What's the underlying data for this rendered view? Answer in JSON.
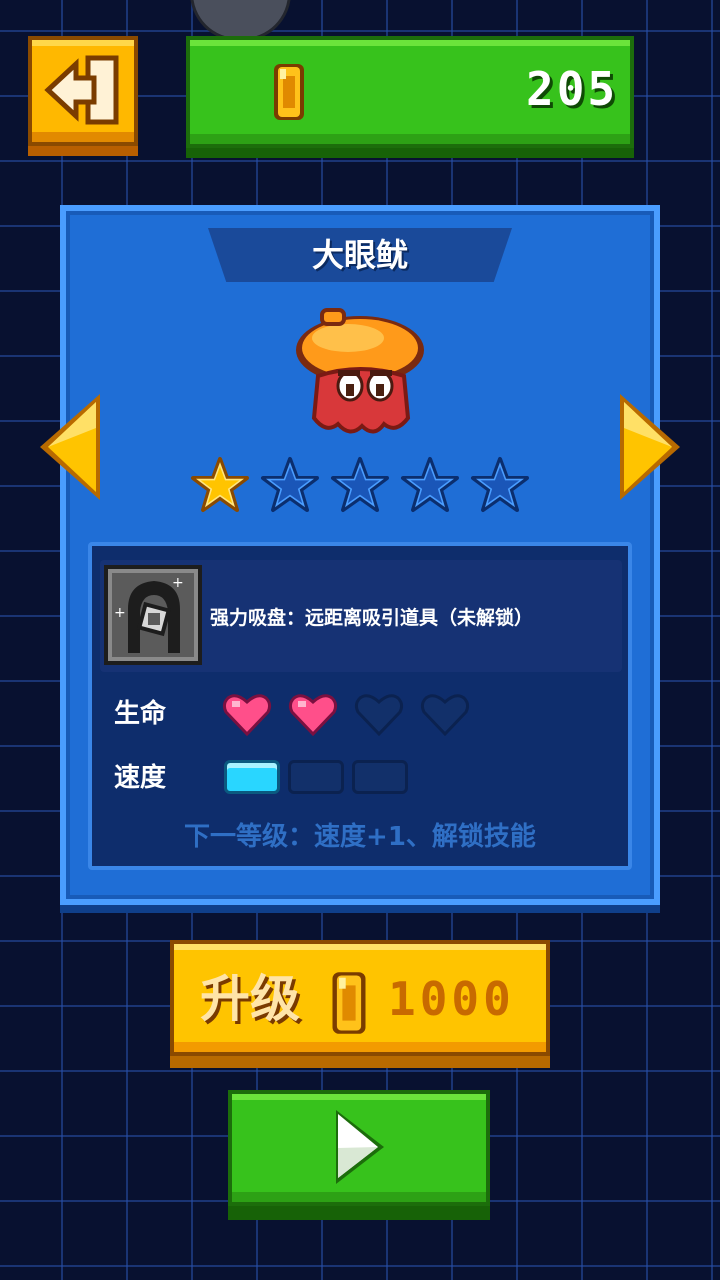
{
  "header": {
    "coins": "205"
  },
  "character": {
    "name": "大眼鱿",
    "stars_filled": 1,
    "stars_total": 5
  },
  "skill": {
    "description": "强力吸盘：远距离吸引道具（未解锁）"
  },
  "stats": {
    "life_label": "生命",
    "life_filled": 2,
    "life_total": 4,
    "speed_label": "速度",
    "speed_filled": 1,
    "speed_total": 3
  },
  "next_level_text": "下一等级：速度+1、解锁技能",
  "upgrade": {
    "label": "升级",
    "cost": "1000"
  },
  "icons": {
    "back": "exit-door-icon",
    "coin": "coin-icon",
    "play": "play-icon",
    "prev": "chevron-left-icon",
    "next": "chevron-right-icon",
    "skill": "suction-cup-icon"
  },
  "colors": {
    "coin_bar": "#37c21c",
    "upgrade_button": "#ffc400",
    "panel": "#1f6ed6",
    "star_filled": "#ffc400",
    "heart_filled": "#ff4f8a",
    "speed_filled": "#29d6ff"
  }
}
